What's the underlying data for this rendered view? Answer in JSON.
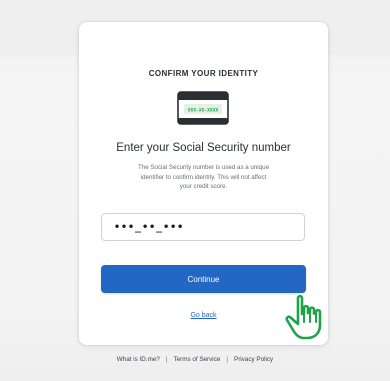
{
  "card": {
    "eyebrow": "CONFIRM YOUR IDENTITY",
    "icon": "ssn-card-icon",
    "heading": "Enter your Social Security number",
    "description_lines": [
      "The Social Security number is used as a unique",
      "identifier to confirm identity. This will not affect",
      "your credit score."
    ],
    "ssn_card_text": "XXX-XX-XXXX",
    "ssn_input_value": "•••_••_•••",
    "continue_label": "Continue",
    "go_back_label": "Go back"
  },
  "footer": {
    "links": [
      "What is ID.me?",
      "Terms of Service",
      "Privacy Policy"
    ],
    "separator": "|"
  },
  "colors": {
    "primary": "#2366c4",
    "cursor_green": "#1fa34a",
    "card_bg": "#ffffff",
    "page_bg": "#f3f3f3"
  },
  "cursor_icon": "hand-pointer-icon"
}
